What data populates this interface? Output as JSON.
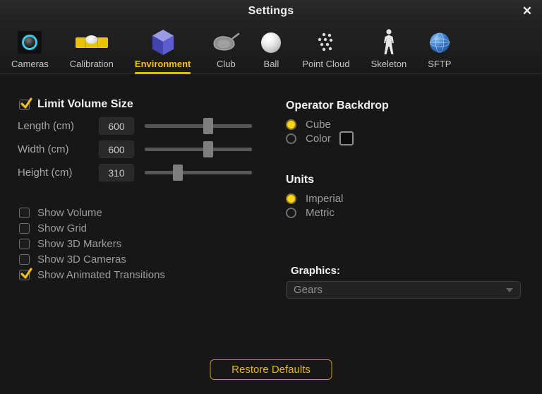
{
  "window": {
    "title": "Settings",
    "close_glyph": "✕"
  },
  "tabs": [
    {
      "label": "Cameras",
      "icon": "camera-lens-icon",
      "selected": false
    },
    {
      "label": "Calibration",
      "icon": "spirit-level-icon",
      "selected": false
    },
    {
      "label": "Environment",
      "icon": "cube-3d-icon",
      "selected": true
    },
    {
      "label": "Club",
      "icon": "golf-club-icon",
      "selected": false
    },
    {
      "label": "Ball",
      "icon": "golf-ball-icon",
      "selected": false
    },
    {
      "label": "Point Cloud",
      "icon": "point-cloud-icon",
      "selected": false
    },
    {
      "label": "Skeleton",
      "icon": "skeleton-icon",
      "selected": false
    },
    {
      "label": "SFTP",
      "icon": "globe-icon",
      "selected": false
    }
  ],
  "left_panel": {
    "limit_volume": {
      "label": "Limit Volume Size",
      "checked": true
    },
    "sliders": [
      {
        "label": "Length (cm)",
        "value": "600",
        "percent": 59
      },
      {
        "label": "Width (cm)",
        "value": "600",
        "percent": 59
      },
      {
        "label": "Height (cm)",
        "value": "310",
        "percent": 31
      }
    ],
    "checkboxes": [
      {
        "label": "Show Volume",
        "checked": false
      },
      {
        "label": "Show Grid",
        "checked": false
      },
      {
        "label": "Show 3D Markers",
        "checked": false
      },
      {
        "label": "Show 3D Cameras",
        "checked": false
      },
      {
        "label": "Show Animated Transitions",
        "checked": true
      }
    ]
  },
  "right_panel": {
    "operator_backdrop": {
      "title": "Operator Backdrop",
      "options": [
        {
          "label": "Cube",
          "selected": true
        },
        {
          "label": "Color",
          "selected": false,
          "has_swatch": true
        }
      ]
    },
    "units": {
      "title": "Units",
      "options": [
        {
          "label": "Imperial",
          "selected": true
        },
        {
          "label": "Metric",
          "selected": false
        }
      ]
    },
    "graphics": {
      "label": "Graphics:",
      "value": "Gears"
    }
  },
  "footer": {
    "restore_button": "Restore Defaults"
  },
  "colors": {
    "accent_yellow": "#f2bb0e",
    "active_tab": "#f3c013",
    "button_border": "#c49a1a",
    "background": "#171717",
    "cube_icon_blue": "#5d5dd0",
    "globe_icon_blue": "#3a79c9",
    "camera_ring_cyan": "#3fc8ea"
  }
}
